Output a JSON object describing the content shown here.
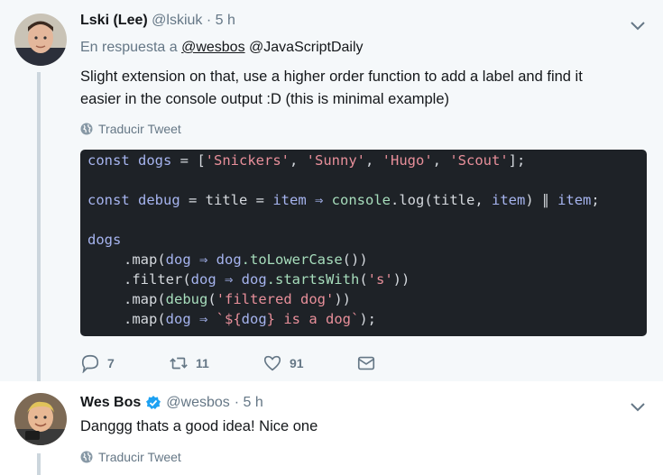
{
  "tweet1": {
    "name": "Lski (Lee)",
    "handle": "@lskiuk",
    "time": "· 5 h",
    "reply_prefix": "En respuesta a",
    "reply_mention1": "@wesbos",
    "reply_mention2": "@JavaScriptDaily",
    "text_line1": "Slight extension on that, use a higher order function to add a label and find it",
    "text_line2": "easier in the console output :D (this is minimal example)",
    "translate_label": "Traducir Tweet",
    "code": {
      "l1_kw": "const",
      "l1_id": "dogs",
      "l1_eq": " = [",
      "l1_s1": "'Snickers'",
      "l1_s2": "'Sunny'",
      "l1_s3": "'Hugo'",
      "l1_s4": "'Scout'",
      "l1_end": "];",
      "l2_kw": "const",
      "l2_id": "debug",
      "l2_rest1": " = title = ",
      "l2_item": "item",
      "l2_arrow": " ⇒ ",
      "l2_fn": "console",
      "l2_rest2": ".log(title, ",
      "l2_item2": "item",
      "l2_rest3": ") ∥ ",
      "l2_item3": "item",
      "l2_end": ";",
      "l3_id": "dogs",
      "l4_a": ".map(",
      "l4_dog": "dog",
      "l4_arrow": " ⇒ ",
      "l4_b": "dog",
      "l4_fn": ".toLowerCase",
      "l4_c": "())",
      "l5_a": ".filter(",
      "l5_dog": "dog",
      "l5_arrow": " ⇒ ",
      "l5_b": "dog",
      "l5_fn": ".startsWith",
      "l5_c": "(",
      "l5_s": "'s'",
      "l5_d": "))",
      "l6_a": ".map(",
      "l6_fn": "debug",
      "l6_b": "(",
      "l6_s": "'filtered dog'",
      "l6_c": "))",
      "l7_a": ".map(",
      "l7_dog": "dog",
      "l7_arrow": " ⇒ ",
      "l7_s1": "`${",
      "l7_id": "dog",
      "l7_s2": "} is a dog`",
      "l7_c": ");"
    },
    "replies": "7",
    "retweets": "11",
    "likes": "91"
  },
  "tweet2": {
    "name": "Wes Bos",
    "handle": "@wesbos",
    "time": "· 5 h",
    "text": "Danggg thats a good idea! Nice one",
    "translate_label": "Traducir Tweet"
  },
  "colors": {
    "thread_bg": "#f5f8fa",
    "code_bg": "#1e2227",
    "verified": "#1da1f2",
    "muted": "#657786"
  }
}
